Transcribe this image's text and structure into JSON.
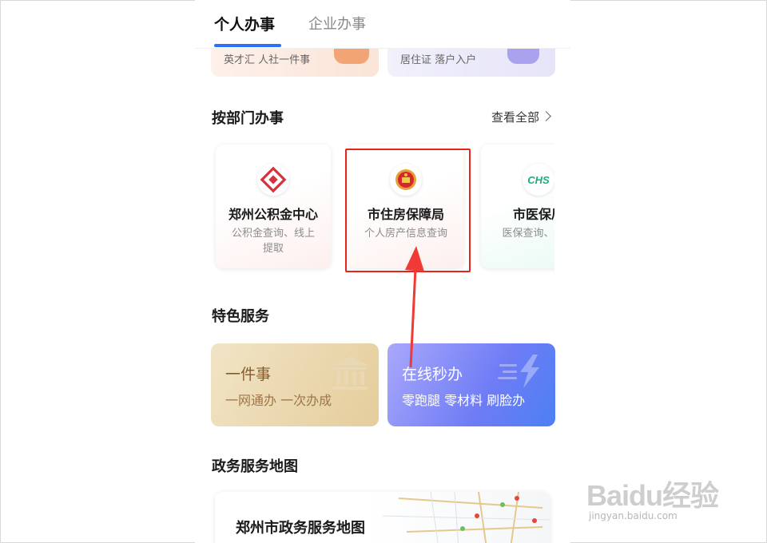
{
  "tabs": {
    "personal": "个人办事",
    "enterprise": "企业办事"
  },
  "top_cards": [
    {
      "text": "英才汇  人社一件事"
    },
    {
      "text": "居住证  落户入户"
    }
  ],
  "department_section": {
    "title": "按部门办事",
    "view_all": "查看全部",
    "cards": [
      {
        "name": "郑州公积金中心",
        "desc": "公积金查询、线上提取",
        "logo": "housing-fund-logo"
      },
      {
        "name": "市住房保障局",
        "desc": "个人房产信息查询",
        "logo": "national-emblem-logo"
      },
      {
        "name": "市医保局",
        "desc": "医保查询、缴费",
        "logo": "chs-logo",
        "logo_text": "CHS"
      }
    ]
  },
  "feature_section": {
    "title": "特色服务",
    "cards": [
      {
        "title": "一件事",
        "subtitle": "一网通办 一次办成",
        "icon": "building-icon"
      },
      {
        "title": "在线秒办",
        "subtitle": "零跑腿 零材料 刷脸办",
        "icon": "lightning-icon"
      }
    ]
  },
  "map_section": {
    "title": "政务服务地图",
    "card_title": "郑州市政务服务地图"
  },
  "watermark": {
    "brand": "Baidu经验",
    "sub": "jingyan.baidu.com"
  },
  "colors": {
    "accent": "#2f6ff5",
    "highlight": "#e8231e",
    "arrow": "#f03a35"
  }
}
